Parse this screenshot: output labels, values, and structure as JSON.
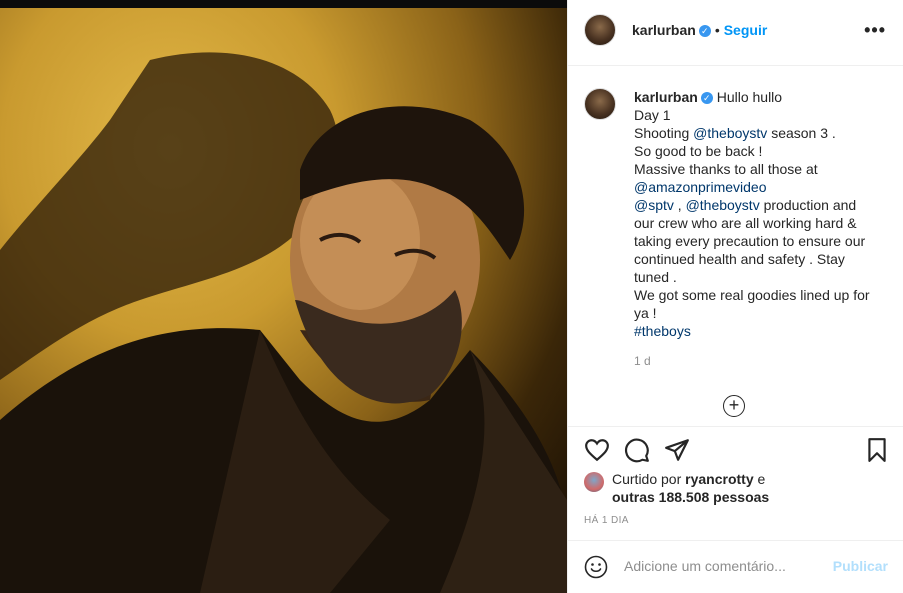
{
  "post": {
    "username": "karlurban",
    "follow_label": "Seguir",
    "more_label": "•••",
    "caption_title": "Hullo hullo",
    "caption_lines": [
      {
        "parts": [
          {
            "t": "Day 1"
          }
        ]
      },
      {
        "parts": [
          {
            "t": "Shooting "
          },
          {
            "t": "@theboystv",
            "link": true
          },
          {
            "t": " season 3 ."
          }
        ]
      },
      {
        "parts": [
          {
            "t": "So good to be back !"
          }
        ]
      },
      {
        "parts": [
          {
            "t": "Massive thanks to all those at"
          }
        ]
      },
      {
        "parts": [
          {
            "t": "@amazonprimevideo",
            "link": true
          }
        ]
      },
      {
        "parts": [
          {
            "t": "@sptv",
            "link": true
          },
          {
            "t": " , "
          },
          {
            "t": "@theboystv",
            "link": true
          },
          {
            "t": " production and"
          }
        ]
      },
      {
        "parts": [
          {
            "t": "our crew who are all working hard &"
          }
        ]
      },
      {
        "parts": [
          {
            "t": "taking every precaution to ensure our"
          }
        ]
      },
      {
        "parts": [
          {
            "t": "continued health and safety . Stay"
          }
        ]
      },
      {
        "parts": [
          {
            "t": "tuned ."
          }
        ]
      },
      {
        "parts": [
          {
            "t": "We got some real goodies lined up for"
          }
        ]
      },
      {
        "parts": [
          {
            "t": "ya !"
          }
        ]
      },
      {
        "parts": [
          {
            "t": "#theboys",
            "link": true
          }
        ]
      }
    ],
    "caption_time": "1 d",
    "likes": {
      "prefix": "Curtido por ",
      "user": "ryancrotty",
      "joiner": " e",
      "others": "outras 188.508 pessoas"
    },
    "date_label": "HÁ 1 DIA",
    "comment_placeholder": "Adicione um comentário...",
    "publish_label": "Publicar"
  },
  "icons": [
    "avatar",
    "verified-badge-icon",
    "heart-icon",
    "comment-icon",
    "share-icon",
    "bookmark-icon",
    "plus-circle-icon",
    "emoji-icon"
  ],
  "colors": {
    "link": "#00376b",
    "follow": "#0095f6",
    "verified": "#3897f0",
    "publish_disabled": "#b2dffc"
  }
}
